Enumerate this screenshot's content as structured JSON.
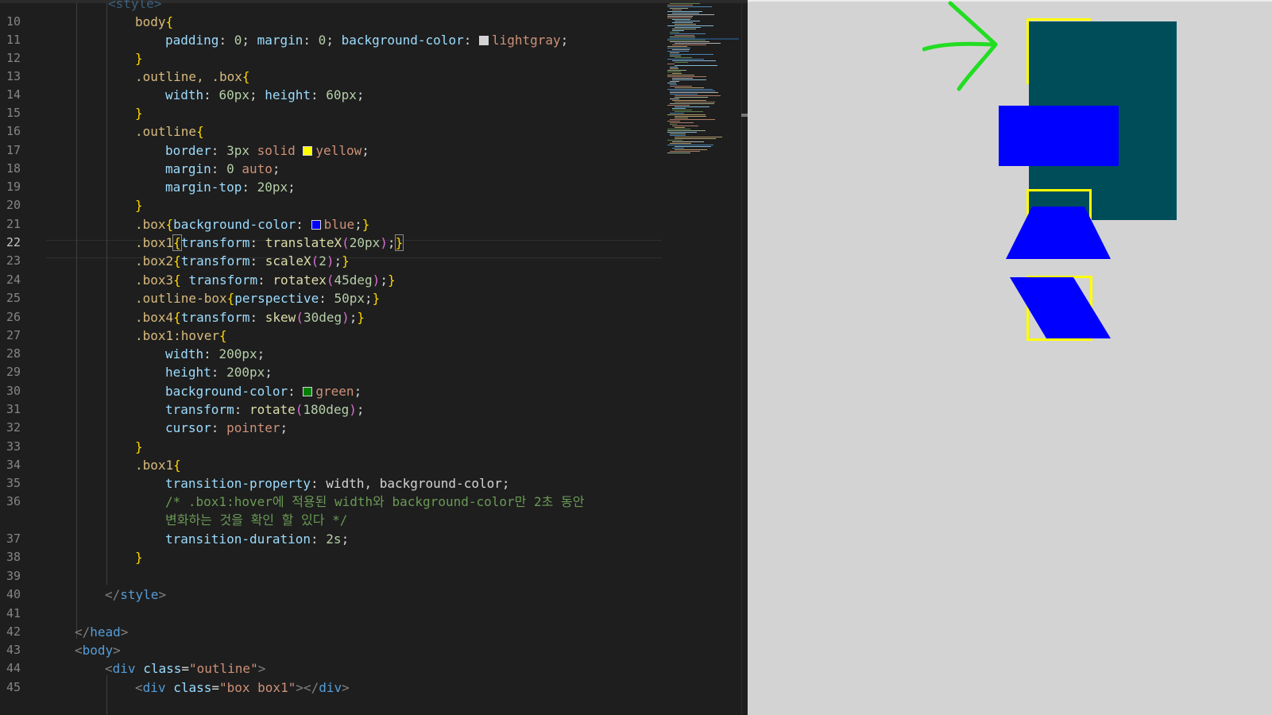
{
  "editor": {
    "line_numbers": [
      "10",
      "11",
      "12",
      "13",
      "14",
      "15",
      "16",
      "17",
      "18",
      "19",
      "20",
      "21",
      "22",
      "23",
      "24",
      "25",
      "26",
      "27",
      "28",
      "29",
      "30",
      "31",
      "32",
      "33",
      "34",
      "35",
      "36",
      "",
      "37",
      "38",
      "39",
      "40",
      "41",
      "42",
      "43",
      "44",
      "45"
    ],
    "active_line": "22",
    "code": {
      "l10_sel": "body",
      "l10_open": "{",
      "l11_p1": "padding",
      "l11_v1": "0",
      "l11_p2": "margin",
      "l11_v2": "0",
      "l11_p3": "background-color",
      "l11_v3": "lightgray",
      "l12_close": "}",
      "l13_sel": ".outline, .box",
      "l13_open": "{",
      "l14_p1": "width",
      "l14_v1": "60px",
      "l14_p2": "height",
      "l14_v2": "60px",
      "l15_close": "}",
      "l16_sel": ".outline",
      "l16_open": "{",
      "l17_prop": "border",
      "l17_num": "3px",
      "l17_kw": "solid",
      "l17_col": "yellow",
      "l18_prop": "margin",
      "l18_num": "0",
      "l18_kw": "auto",
      "l19_prop": "margin-top",
      "l19_num": "20px",
      "l20_close": "}",
      "l21_sel": ".box",
      "l21_prop": "background-color",
      "l21_col": "blue",
      "l22_sel": ".box1",
      "l22_prop": "transform",
      "l22_fn": "translateX",
      "l22_num": "20px",
      "l23_sel": ".box2",
      "l23_prop": "transform",
      "l23_fn": "scaleX",
      "l23_num": "2",
      "l24_sel": ".box3",
      "l24_prop": "transform",
      "l24_fn": "rotatex",
      "l24_num": "45deg",
      "l25_sel": ".outline-box",
      "l25_prop": "perspective",
      "l25_num": "50px",
      "l26_sel": ".box4",
      "l26_prop": "transform",
      "l26_fn": "skew",
      "l26_num": "30deg",
      "l27_sel": ".box1:hover",
      "l27_open": "{",
      "l28_prop": "width",
      "l28_num": "200px",
      "l29_prop": "height",
      "l29_num": "200px",
      "l30_prop": "background-color",
      "l30_col": "green",
      "l31_prop": "transform",
      "l31_fn": "rotate",
      "l31_num": "180deg",
      "l32_prop": "cursor",
      "l32_val": "pointer",
      "l33_close": "}",
      "l34_sel": ".box1",
      "l34_open": "{",
      "l35_prop": "transition-property",
      "l35_val": "width, background-color",
      "l36_cmt_a": "/* .box1:hover에 적용된 width와 background-color만 2초 동안",
      "l36_cmt_b": "변화하는 것을 확인 할 있다 */",
      "l37_prop": "transition-duration",
      "l37_num": "2s",
      "l38_close": "}",
      "l40_tag": "style",
      "l42_tag": "head",
      "l43_tag": "body",
      "l44_tag": "div",
      "l44_attr": "class",
      "l44_val": "\"outline\"",
      "l45_tag": "div",
      "l45_attr": "class",
      "l45_val": "\"box box1\"",
      "l45_close_tag": "div",
      "top_partial": "<style>"
    },
    "swatch_colors": {
      "lightgray": "#d3d3d3",
      "yellow": "#ffff00",
      "blue": "#0000ff",
      "green": "#008000"
    }
  },
  "preview": {
    "background": "#d3d3d3",
    "hover_box_color": "#004d5a",
    "box_color": "#0000ff",
    "outline_color": "#ffff00",
    "arrow_color": "#22dd22",
    "arrow_icon": "hand-drawn-arrow-icon"
  }
}
